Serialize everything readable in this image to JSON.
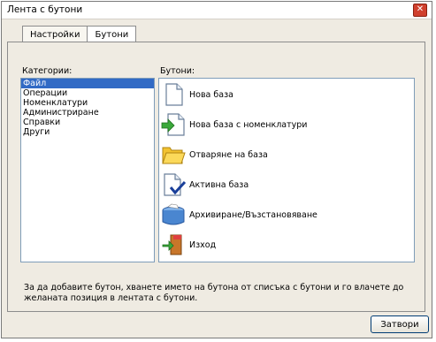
{
  "window": {
    "title": "Лента с бутони",
    "close_glyph": "✕"
  },
  "tabs": [
    {
      "label": "Настройки",
      "active": false
    },
    {
      "label": "Бутони",
      "active": true
    }
  ],
  "categories": {
    "label": "Категории:",
    "items": [
      "Файл",
      "Операции",
      "Номенклатури",
      "Администриране",
      "Справки",
      "Други"
    ],
    "selected_index": 0
  },
  "buttons": {
    "label": "Бутони:",
    "items": [
      {
        "label": "Нова база",
        "icon": "new-document-icon"
      },
      {
        "label": "Нова база с номенклатури",
        "icon": "new-document-arrow-icon"
      },
      {
        "label": "Отваряне на база",
        "icon": "folder-icon"
      },
      {
        "label": "Активна база",
        "icon": "document-check-icon"
      },
      {
        "label": "Архивиране/Възстановяване",
        "icon": "archive-box-icon"
      },
      {
        "label": "Изход",
        "icon": "exit-door-icon"
      }
    ]
  },
  "hint": "За да добавите бутон, хванете името на бутона от списъка с бутони и го влачете до желаната позиция в лентата с бутони.",
  "footer": {
    "close_label": "Затвори"
  },
  "colors": {
    "selection": "#316ac5",
    "title_close": "#d0402e",
    "dialog_bg": "#efebe2"
  }
}
